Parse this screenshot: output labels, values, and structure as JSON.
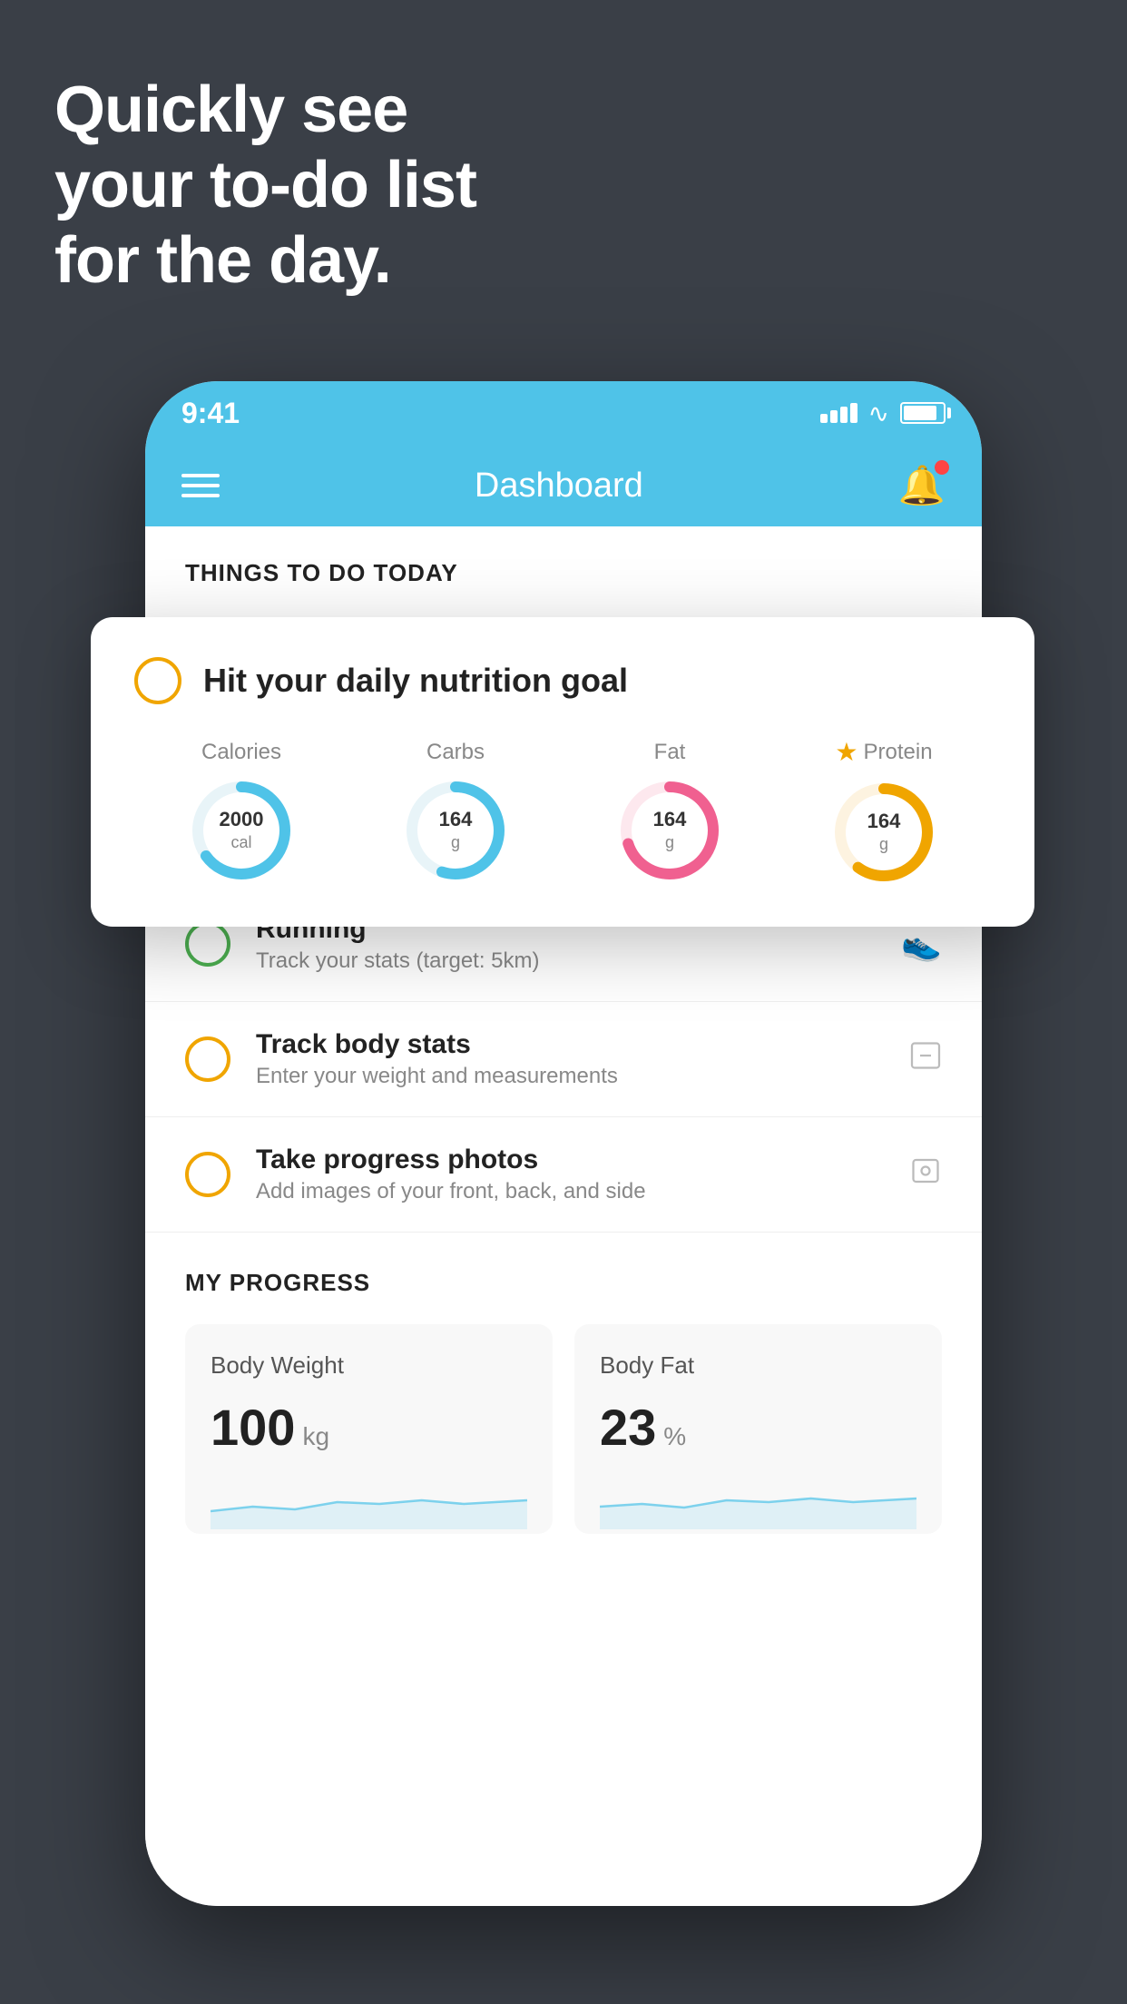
{
  "hero": {
    "title": "Quickly see\nyour to-do list\nfor the day."
  },
  "statusBar": {
    "time": "9:41"
  },
  "navBar": {
    "title": "Dashboard"
  },
  "thingsToDo": {
    "sectionTitle": "THINGS TO DO TODAY",
    "nutritionCard": {
      "checkCircleColor": "#f0a500",
      "title": "Hit your daily nutrition goal",
      "items": [
        {
          "label": "Calories",
          "value": "2000",
          "unit": "cal",
          "color": "#4fc3e8",
          "progress": 0.65,
          "hasStar": false
        },
        {
          "label": "Carbs",
          "value": "164",
          "unit": "g",
          "color": "#4fc3e8",
          "progress": 0.55,
          "hasStar": false
        },
        {
          "label": "Fat",
          "value": "164",
          "unit": "g",
          "color": "#f06090",
          "progress": 0.7,
          "hasStar": false
        },
        {
          "label": "Protein",
          "value": "164",
          "unit": "g",
          "color": "#f0a500",
          "progress": 0.6,
          "hasStar": true
        }
      ]
    },
    "todos": [
      {
        "name": "Running",
        "desc": "Track your stats (target: 5km)",
        "circleColor": "green",
        "icon": "👟"
      },
      {
        "name": "Track body stats",
        "desc": "Enter your weight and measurements",
        "circleColor": "yellow",
        "icon": "⚖"
      },
      {
        "name": "Take progress photos",
        "desc": "Add images of your front, back, and side",
        "circleColor": "yellow",
        "icon": "🖼"
      }
    ]
  },
  "progress": {
    "sectionTitle": "MY PROGRESS",
    "cards": [
      {
        "title": "Body Weight",
        "value": "100",
        "unit": "kg"
      },
      {
        "title": "Body Fat",
        "value": "23",
        "unit": "%"
      }
    ]
  }
}
